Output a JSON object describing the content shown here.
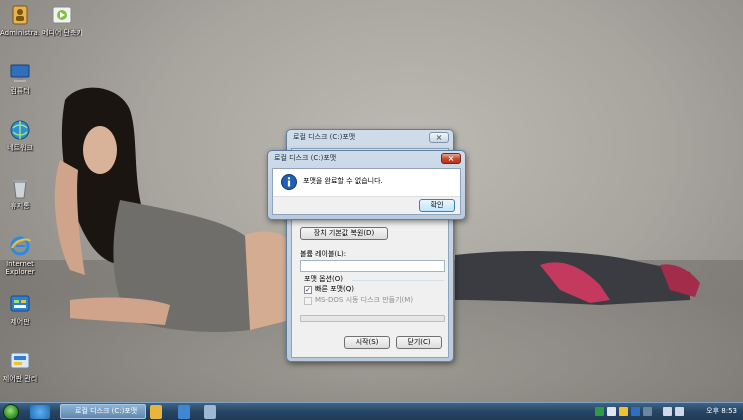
{
  "desktop": {
    "icons": [
      {
        "label": "Administra...",
        "icon": "user-folder-icon"
      },
      {
        "label": "메디어\n단축키...",
        "icon": "media-shortcut-icon"
      },
      {
        "label": "컴퓨터",
        "icon": "computer-icon"
      },
      {
        "label": "네트워크",
        "icon": "network-icon"
      },
      {
        "label": "휴지통",
        "icon": "recycle-bin-icon"
      },
      {
        "label": "Internet Explorer",
        "icon": "internet-explorer-icon"
      },
      {
        "label": "제어판",
        "icon": "control-panel-icon"
      },
      {
        "label": "제어판 관리",
        "icon": "control-panel-manage-icon"
      }
    ]
  },
  "format_window": {
    "title": "로컬 디스크 (C:)포맷",
    "restore_defaults_button": "장치 기본값 복원(D)",
    "volume_label_label": "볼륨 레이블(L):",
    "volume_label_value": "",
    "format_options_label": "포맷 옵션(O)",
    "quick_format_label": "빠른 포맷(Q)",
    "quick_format_checked": "✓",
    "msdos_label": "MS-DOS 시동 디스크 만들기(M)",
    "start_button": "시작(S)",
    "close_button": "닫기(C)"
  },
  "message_box": {
    "title": "로컬 디스크 (C:)포맷",
    "message": "포맷을 완료할 수 없습니다.",
    "ok_button": "확인",
    "icon": "info-icon"
  },
  "taskbar": {
    "active_task_label": "로컬 디스크 (C:)포맷",
    "clock": "오후 8:53"
  },
  "colors": {
    "taskbar": "#274564",
    "window_frame": "#b9cadd",
    "close_button_red": "#c8452f",
    "info_blue": "#1f5fb5"
  }
}
